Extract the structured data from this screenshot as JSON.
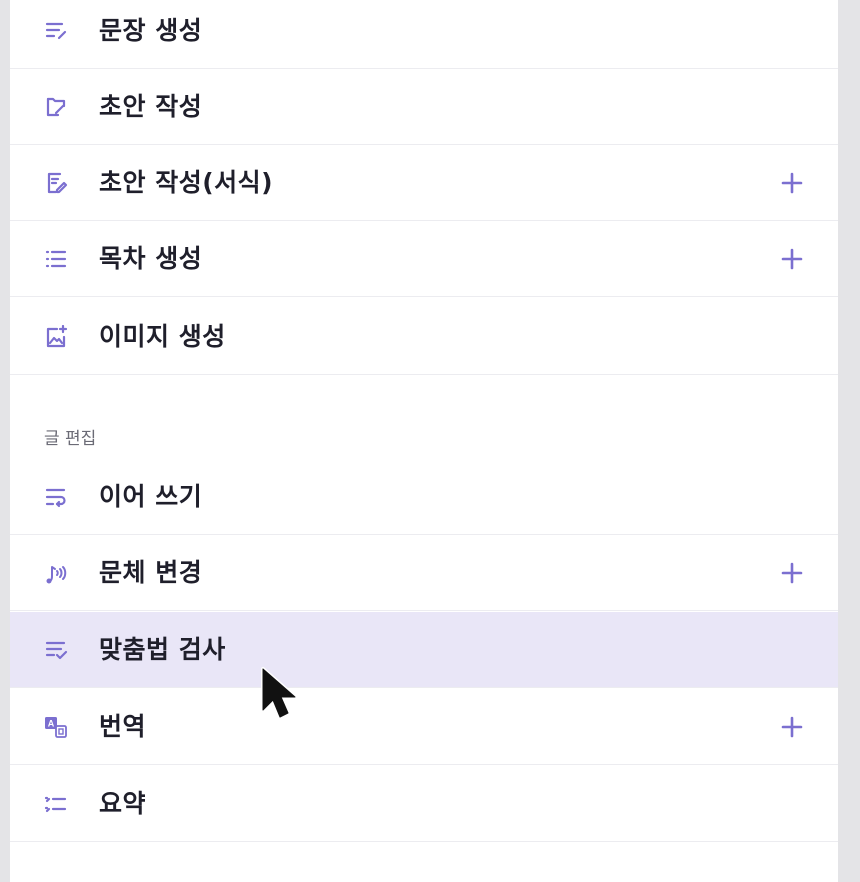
{
  "theme": {
    "accent": "#7b6fd0",
    "active_row_bg": "#e9e6f7",
    "divider": "#ececf0"
  },
  "menu_top": [
    {
      "label": "문장 생성",
      "icon": "sentence-lines-icon",
      "has_plus": false
    },
    {
      "label": "초안 작성",
      "icon": "draft-folder-icon",
      "has_plus": false
    },
    {
      "label": "초안 작성(서식)",
      "icon": "document-edit-icon",
      "has_plus": true
    },
    {
      "label": "목차 생성",
      "icon": "list-icon",
      "has_plus": true
    },
    {
      "label": "이미지 생성",
      "icon": "image-add-icon",
      "has_plus": false
    }
  ],
  "section": {
    "title": "글 편집"
  },
  "menu_edit": [
    {
      "label": "이어 쓰기",
      "icon": "wrap-text-icon",
      "has_plus": false
    },
    {
      "label": "문체 변경",
      "icon": "style-change-icon",
      "has_plus": true
    },
    {
      "label": "맞춤법 검사",
      "icon": "spellcheck-icon",
      "has_plus": false,
      "active": true
    },
    {
      "label": "번역",
      "icon": "translate-icon",
      "has_plus": true
    },
    {
      "label": "요약",
      "icon": "summary-list-icon",
      "has_plus": false
    }
  ]
}
